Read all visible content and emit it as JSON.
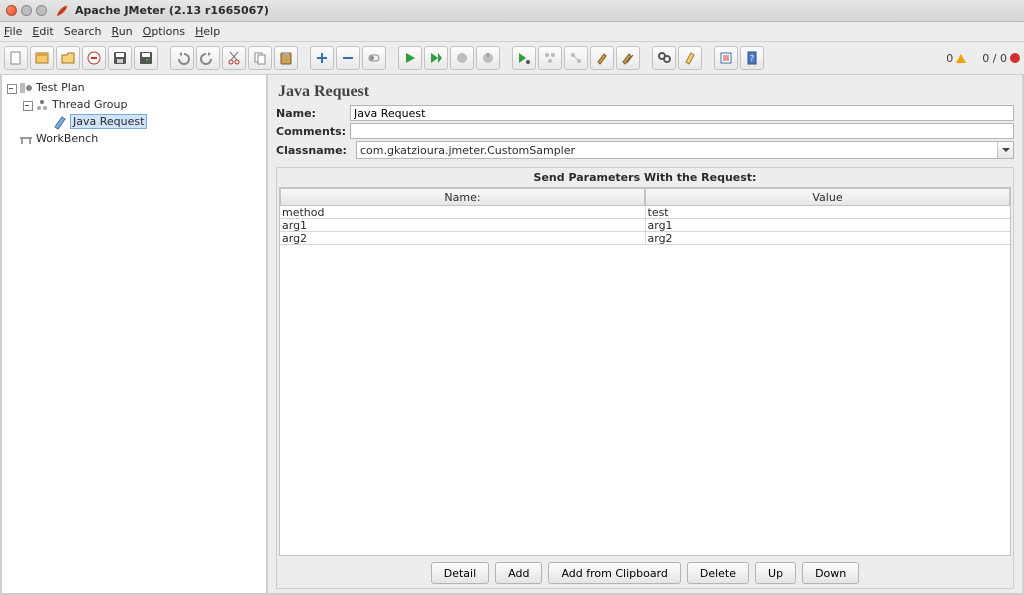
{
  "window": {
    "title": "Apache JMeter (2.13 r1665067)"
  },
  "menu": {
    "file": "File",
    "edit": "Edit",
    "search": "Search",
    "run": "Run",
    "options": "Options",
    "help": "Help"
  },
  "status": {
    "warn_count": "0",
    "ratio": "0 / 0"
  },
  "tree": {
    "test_plan": "Test Plan",
    "thread_group": "Thread Group",
    "java_request": "Java Request",
    "workbench": "WorkBench"
  },
  "panel": {
    "title": "Java Request",
    "name_label": "Name:",
    "name_value": "Java Request",
    "comments_label": "Comments:",
    "comments_value": "",
    "classname_label": "Classname:",
    "classname_value": "com.gkatzioura.jmeter.CustomSampler",
    "params_title": "Send Parameters With the Request:",
    "columns": {
      "name": "Name:",
      "value": "Value"
    },
    "rows": [
      {
        "name": "method",
        "value": "test"
      },
      {
        "name": "arg1",
        "value": "arg1"
      },
      {
        "name": "arg2",
        "value": "arg2"
      }
    ],
    "buttons": {
      "detail": "Detail",
      "add": "Add",
      "add_clip": "Add from Clipboard",
      "delete": "Delete",
      "up": "Up",
      "down": "Down"
    }
  }
}
